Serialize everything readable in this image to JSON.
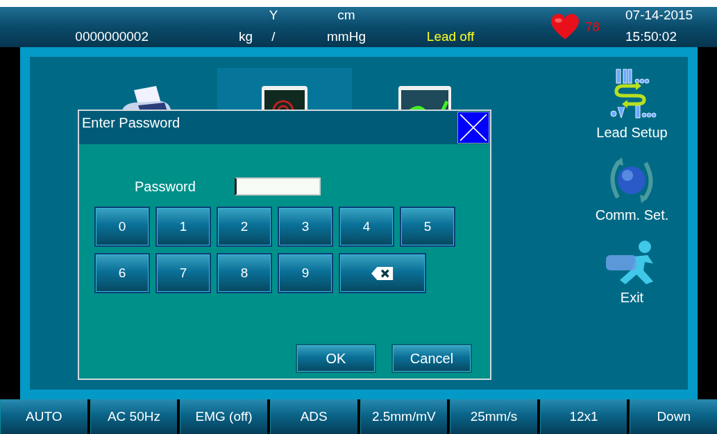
{
  "header": {
    "patient_id": "0000000002",
    "weight_unit": "kg",
    "age_unit": "Y",
    "bp_separator": "/",
    "height_unit": "cm",
    "bp_unit": "mmHg",
    "lead_status": "Lead off",
    "heart_rate": "78",
    "date": "07-14-2015",
    "time": "15:50:02"
  },
  "menu": {
    "hidden_tiles": [
      {
        "kind": "printer",
        "selected": false
      },
      {
        "kind": "monitor",
        "selected": true
      },
      {
        "kind": "waveform",
        "selected": false
      }
    ],
    "items": [
      {
        "kind": "lead",
        "label": "Lead Setup"
      },
      {
        "kind": "comm",
        "label": "Comm. Set."
      },
      {
        "kind": "exit",
        "label": "Exit"
      }
    ]
  },
  "dialog": {
    "title": "Enter Password",
    "password_label": "Password",
    "keys": [
      {
        "kind": "digit",
        "label": "0"
      },
      {
        "kind": "digit",
        "label": "1"
      },
      {
        "kind": "digit",
        "label": "2"
      },
      {
        "kind": "digit",
        "label": "3"
      },
      {
        "kind": "digit",
        "label": "4"
      },
      {
        "kind": "digit",
        "label": "5"
      },
      {
        "kind": "digit",
        "label": "6"
      },
      {
        "kind": "digit",
        "label": "7"
      },
      {
        "kind": "digit",
        "label": "8"
      },
      {
        "kind": "digit",
        "label": "9"
      },
      {
        "kind": "backspace"
      }
    ],
    "buttons": [
      "OK",
      "Cancel"
    ]
  },
  "footer": [
    "AUTO",
    "AC 50Hz",
    "EMG (off)",
    "ADS",
    "2.5mm/mV",
    "25mm/s",
    "12x1",
    "Down"
  ]
}
